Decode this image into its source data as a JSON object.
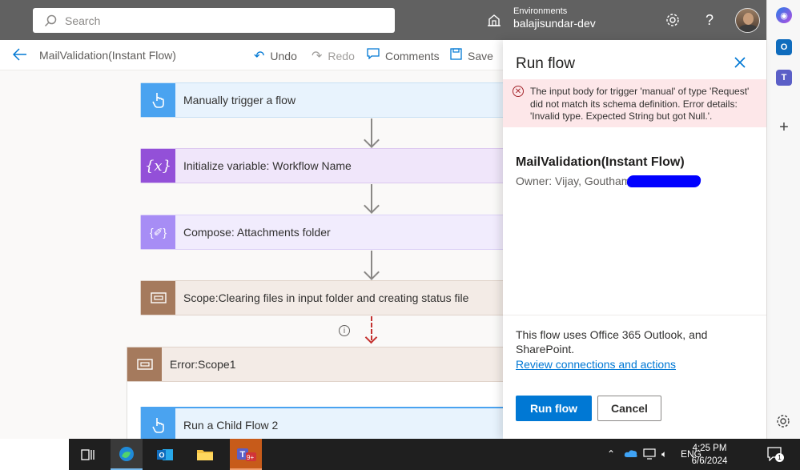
{
  "header": {
    "search_placeholder": "Search",
    "environments_label": "Environments",
    "environment_name": "balajisundar-dev"
  },
  "commandbar": {
    "flow_name": "MailValidation(Instant Flow)",
    "undo": "Undo",
    "redo": "Redo",
    "comments": "Comments",
    "save": "Save"
  },
  "canvas": {
    "steps": [
      {
        "title": "Manually trigger a flow",
        "color": "#4aa3f0"
      },
      {
        "title": "Initialize variable: Workflow Name",
        "color": "#9350d8"
      },
      {
        "title": "Compose: Attachments folder",
        "color": "#a78df5"
      },
      {
        "title": "Scope:Clearing files in input folder and creating status file",
        "color": "#a57a5d"
      },
      {
        "title": "Error:Scope1",
        "color": "#a57a5d"
      },
      {
        "title": "Run a Child Flow 2",
        "color": "#4aa3f0"
      }
    ],
    "error_arrow_color": "#c4312f"
  },
  "panel": {
    "title": "Run flow",
    "error_message": "The input body for trigger 'manual' of type 'Request' did not match its schema definition. Error details: 'Invalid type. Expected String but got Null.'.",
    "flow_title": "MailValidation(Instant Flow)",
    "owner": "Owner: Vijay, Goutham",
    "connections_text": "This flow uses Office 365 Outlook, and SharePoint.",
    "review_link": "Review connections and actions",
    "run_button": "Run flow",
    "cancel_button": "Cancel"
  },
  "taskbar": {
    "apps": [
      "task-view-icon",
      "edge-icon",
      "outlook-icon",
      "file-explorer-icon",
      "teams-icon"
    ],
    "teams_badge": "9+",
    "language": "ENG",
    "time": "4:25 PM",
    "date": "6/6/2024",
    "notification_count": "1"
  },
  "colors": {
    "accent": "#0078d4",
    "header": "#616161",
    "error_bg": "#fde7e9"
  }
}
